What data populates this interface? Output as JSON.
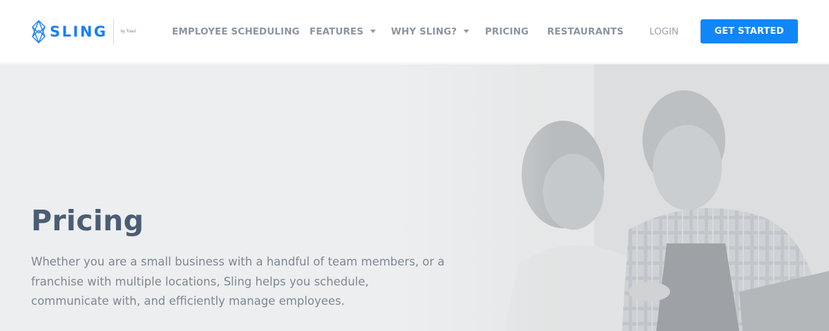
{
  "brand": {
    "name": "SLING",
    "sub": "by Toast",
    "color": "#1a7ff5"
  },
  "nav": {
    "items": [
      {
        "label": "EMPLOYEE SCHEDULING",
        "has_dropdown": false
      },
      {
        "label": "FEATURES",
        "has_dropdown": true
      },
      {
        "label": "WHY SLING?",
        "has_dropdown": true
      },
      {
        "label": "PRICING",
        "has_dropdown": false
      },
      {
        "label": "RESTAURANTS",
        "has_dropdown": false
      }
    ],
    "login": "LOGIN",
    "cta": "GET STARTED",
    "cta_color": "#1186f6"
  },
  "hero": {
    "title": "Pricing",
    "description": "Whether you are a small business with a handful of team members, or a franchise with multiple locations, Sling helps you schedule, communicate with, and efficiently manage employees."
  },
  "icons": [
    "sling-logo-icon",
    "chevron-down-icon"
  ]
}
